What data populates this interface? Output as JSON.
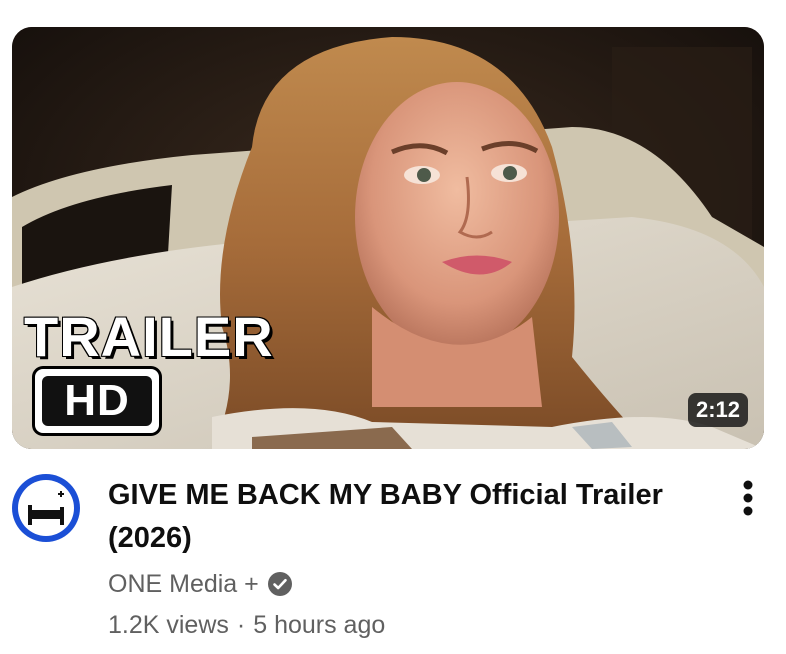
{
  "video": {
    "thumbnail_overlay": {
      "trailer": "TRAILER",
      "hd": "HD"
    },
    "duration": "2:12",
    "title": "GIVE ME BACK MY BABY Official Trailer (2026)",
    "channel": "ONE Media +",
    "views": "1.2K views",
    "separator": "·",
    "age": "5 hours ago"
  },
  "icons": {
    "avatar": "hospital-bed-logo-icon",
    "verified": "verified-check-icon",
    "more": "more-vert-icon"
  },
  "colors": {
    "avatar_ring": "#1b4fd6",
    "title": "#0f0f0f",
    "meta": "#606060"
  }
}
